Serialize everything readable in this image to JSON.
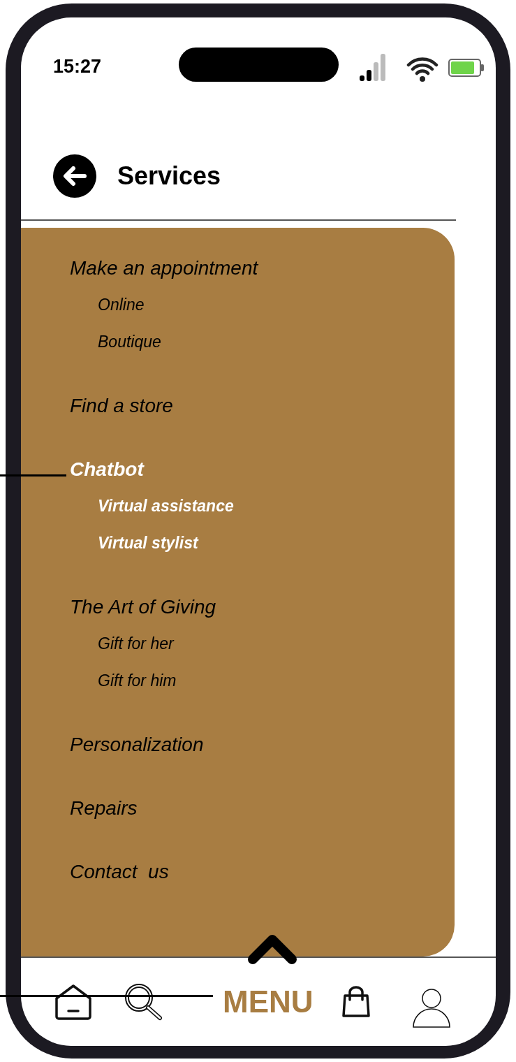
{
  "status_bar": {
    "time": "15:27"
  },
  "header": {
    "title": "Services"
  },
  "menu": {
    "sections": [
      {
        "label": "Make an appointment",
        "selected": false,
        "children": [
          {
            "label": "Online"
          },
          {
            "label": "Boutique"
          }
        ]
      },
      {
        "label": "Find a store",
        "selected": false
      },
      {
        "label": "Chatbot",
        "selected": true,
        "children": [
          {
            "label": "Virtual assistance"
          },
          {
            "label": "Virtual stylist"
          }
        ]
      },
      {
        "label": "The Art of Giving",
        "selected": false,
        "children": [
          {
            "label": "Gift for her"
          },
          {
            "label": "Gift for him"
          }
        ]
      },
      {
        "label": "Personalization",
        "selected": false
      },
      {
        "label": "Repairs",
        "selected": false
      },
      {
        "label": "Contact  us",
        "selected": false
      }
    ]
  },
  "bottom_nav": {
    "menu_label": "MENU"
  }
}
